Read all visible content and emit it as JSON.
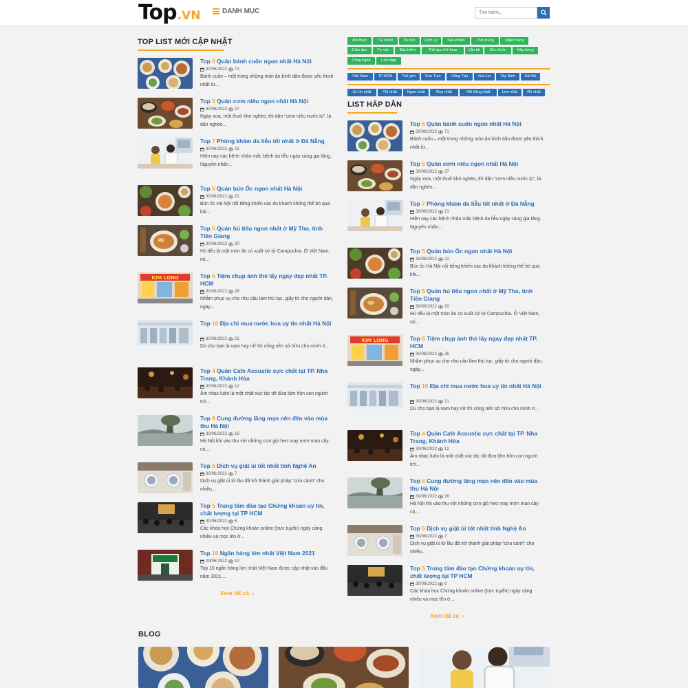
{
  "header": {
    "logo_main": "Top",
    "logo_suffix": ".VN",
    "category_label": "DANH MỤC",
    "search_placeholder": "Tìm kiếm..."
  },
  "colors": {
    "accent": "#f5a623",
    "link": "#2a6db5",
    "tag_green": "#2fb35c",
    "tag_blue": "#2a6db5"
  },
  "left": {
    "title": "TOP LIST MỚI CẬP NHẬT",
    "see_all": "Xem tất cả",
    "articles": [
      {
        "num": "6",
        "title": "Quán bánh cuốn ngon nhất Hà Nội",
        "date": "30/06/2022",
        "views": "71",
        "desc": "Bánh cuốn – một trong những món ăn bình dân được yêu thích nhất từ...",
        "img": "food1"
      },
      {
        "num": "5",
        "title": "Quán cơm niêu ngon nhất Hà Nội",
        "date": "30/06/2022",
        "views": "37",
        "desc": "Ngày xưa, một thuở khó nghèo, thì dân “cơm niêu nước lọ”, là dân nghèo...",
        "img": "food2"
      },
      {
        "num": "7",
        "title": "Phòng khám da liễu tốt nhất ở Đà Nẵng",
        "date": "30/06/2022",
        "views": "21",
        "desc": "Hiện nay các bệnh nhân mắc bệnh da liễu ngày càng gia tăng. Nguyên nhân...",
        "img": "clinic"
      },
      {
        "num": "5",
        "title": "Quán bún Ốc ngon nhất Hà Nội",
        "date": "30/06/2022",
        "views": "22",
        "desc": "Bún ốc Hà Nội nổi tiếng khiến các du khách không thể bỏ qua khi...",
        "img": "food3"
      },
      {
        "num": "5",
        "title": "Quán hủ tiếu ngon nhất ở Mỹ Tho, tỉnh Tiền Giang",
        "date": "30/06/2022",
        "views": "20",
        "desc": "Hủ tiếu là một món ăn có xuất xứ từ Campuchia. Ở Việt Nam, nó...",
        "img": "food4"
      },
      {
        "num": "6",
        "title": "Tiệm chụp ảnh thẻ lấy ngay đẹp nhất TP. HCM",
        "date": "30/06/2022",
        "views": "26",
        "desc": "Nhằm phục vụ cho nhu cầu làm thủ tục, giấy tờ cho người dân, ngày...",
        "img": "shop"
      },
      {
        "num": "10",
        "title": "Địa chỉ mua nước hoa uy tín nhất Hà Nội",
        "date": "30/06/2022",
        "views": "21",
        "desc": "Dù cho bạn là nam hay nữ thì cũng nên sở hữu cho mình ít...",
        "img": "store"
      },
      {
        "num": "4",
        "title": "Quán Cafe Acoustic cực chất tại TP. Nha Trang, Khánh Hòa",
        "date": "30/06/2022",
        "views": "12",
        "desc": "Âm nhạc luôn là một chất xúc tác tốt đưa tâm hồn con người trở...",
        "img": "cafe"
      },
      {
        "num": "8",
        "title": "Cung đường lãng mạn nên đến vào mùa thu Hà Nội",
        "date": "30/06/2022",
        "views": "16",
        "desc": "Hà Nội khi vào thu với những cơn gió heo may mơn man cây cỏ,...",
        "img": "lake"
      },
      {
        "num": "5",
        "title": "Dịch vụ giặt ủi tốt nhất tỉnh Nghệ An",
        "date": "30/06/2022",
        "views": "7",
        "desc": "Dịch vụ giặt ủi từ lâu đã trở thành giải pháp “cứu cánh” cho nhiều...",
        "img": "laundry"
      },
      {
        "num": "5",
        "title": "Trung tâm đào tạo Chứng khoán uy tín, chất lượng tại TP HCM",
        "date": "30/06/2022",
        "views": "6",
        "desc": "Các khóa học Chứng khoán online (trực tuyến) ngày càng nhiều và mọc lên ở...",
        "img": "class"
      },
      {
        "num": "10",
        "title": "Ngân hàng lớn nhất Việt Nam 2021",
        "date": "29/06/2022",
        "views": "10",
        "desc": "Top 10 ngân hàng lớn nhất Việt Nam được cập nhật vào đầu năm 2021....",
        "img": "bank"
      }
    ]
  },
  "tags": {
    "row1": [
      "Ẩm thực",
      "Tài chính",
      "Du lịch",
      "Dịch vụ",
      "Sản phẩm",
      "Thời trang",
      "Ngân hàng"
    ],
    "row2": [
      "Giáo dục",
      "Tư vấn",
      "Bảo hiểm",
      "Thể dục thể thao",
      "Vận tải",
      "Sức khỏe",
      "Xây dựng"
    ],
    "row3": [
      "Công nghệ",
      "Làm đẹp"
    ],
    "places": [
      "Việt Nam",
      "TP.HCM",
      "Thế giới",
      "Kon Tum",
      "Vũng Tàu",
      "Gia Lai",
      "Tây Ninh",
      "Hà Nội"
    ],
    "qualities": [
      "Uy tín nhất",
      "Tốt nhất",
      "Ngon nhất",
      "Đẹp nhất",
      "Nổi tiếng nhất",
      "Lớn nhất",
      "Rẻ nhất"
    ]
  },
  "right": {
    "title": "LIST HẤP DẪN",
    "see_all": "Xem tất cả",
    "articles": [
      {
        "num": "6",
        "title": "Quán bánh cuốn ngon nhất Hà Nội",
        "date": "30/06/2022",
        "views": "71",
        "desc": "Bánh cuốn – một trong những món ăn bình dân được yêu thích nhất từ...",
        "img": "food1"
      },
      {
        "num": "5",
        "title": "Quán cơm niêu ngon nhất Hà Nội",
        "date": "30/06/2022",
        "views": "37",
        "desc": "Ngày xưa, một thuở khó nghèo, thì dân “cơm niêu nước lọ”, là dân nghèo...",
        "img": "food2"
      },
      {
        "num": "7",
        "title": "Phòng khám da liễu tốt nhất ở Đà Nẵng",
        "date": "30/06/2022",
        "views": "21",
        "desc": "Hiện nay các bệnh nhân mắc bệnh da liễu ngày càng gia tăng. Nguyên nhân...",
        "img": "clinic"
      },
      {
        "num": "5",
        "title": "Quán bún Ốc ngon nhất Hà Nội",
        "date": "30/06/2022",
        "views": "22",
        "desc": "Bún ốc Hà Nội nổi tiếng khiến các du khách không thể bỏ qua khi...",
        "img": "food3"
      },
      {
        "num": "5",
        "title": "Quán hủ tiếu ngon nhất ở Mỹ Tho, tỉnh Tiền Giang",
        "date": "30/06/2022",
        "views": "20",
        "desc": "Hủ tiếu là một món ăn có xuất xứ từ Campuchia. Ở Việt Nam, nó...",
        "img": "food4"
      },
      {
        "num": "6",
        "title": "Tiệm chụp ảnh thẻ lấy ngay đẹp nhất TP. HCM",
        "date": "30/06/2022",
        "views": "26",
        "desc": "Nhằm phục vụ cho nhu cầu làm thủ tục, giấy tờ cho người dân, ngày...",
        "img": "shop"
      },
      {
        "num": "10",
        "title": "Địa chỉ mua nước hoa uy tín nhất Hà Nội",
        "date": "30/06/2022",
        "views": "21",
        "desc": "Dù cho bạn là nam hay nữ thì cũng nên sở hữu cho mình ít...",
        "img": "store"
      },
      {
        "num": "4",
        "title": "Quán Cafe Acoustic cực chất tại TP. Nha Trang, Khánh Hòa",
        "date": "30/06/2022",
        "views": "12",
        "desc": "Âm nhạc luôn là một chất xúc tác tốt đưa tâm hồn con người trở...",
        "img": "cafe"
      },
      {
        "num": "8",
        "title": "Cung đường lãng mạn nên đến vào mùa thu Hà Nội",
        "date": "30/06/2022",
        "views": "16",
        "desc": "Hà Nội khi vào thu với những cơn gió heo may mơn man cây cỏ,...",
        "img": "lake"
      },
      {
        "num": "5",
        "title": "Dịch vụ giặt ủi tốt nhất tỉnh Nghệ An",
        "date": "30/06/2022",
        "views": "7",
        "desc": "Dịch vụ giặt ủi từ lâu đã trở thành giải pháp “cứu cánh” cho nhiều...",
        "img": "laundry"
      },
      {
        "num": "5",
        "title": "Trung tâm đào tạo Chứng khoán uy tín, chất lượng tại TP HCM",
        "date": "30/06/2022",
        "views": "6",
        "desc": "Các khóa học Chứng khoán online (trực tuyến) ngày càng nhiều và mọc lên ở...",
        "img": "class"
      }
    ]
  },
  "blog": {
    "title": "BLOG",
    "cards": [
      {
        "img": "food1"
      },
      {
        "img": "food2"
      },
      {
        "img": "clinic"
      }
    ]
  }
}
